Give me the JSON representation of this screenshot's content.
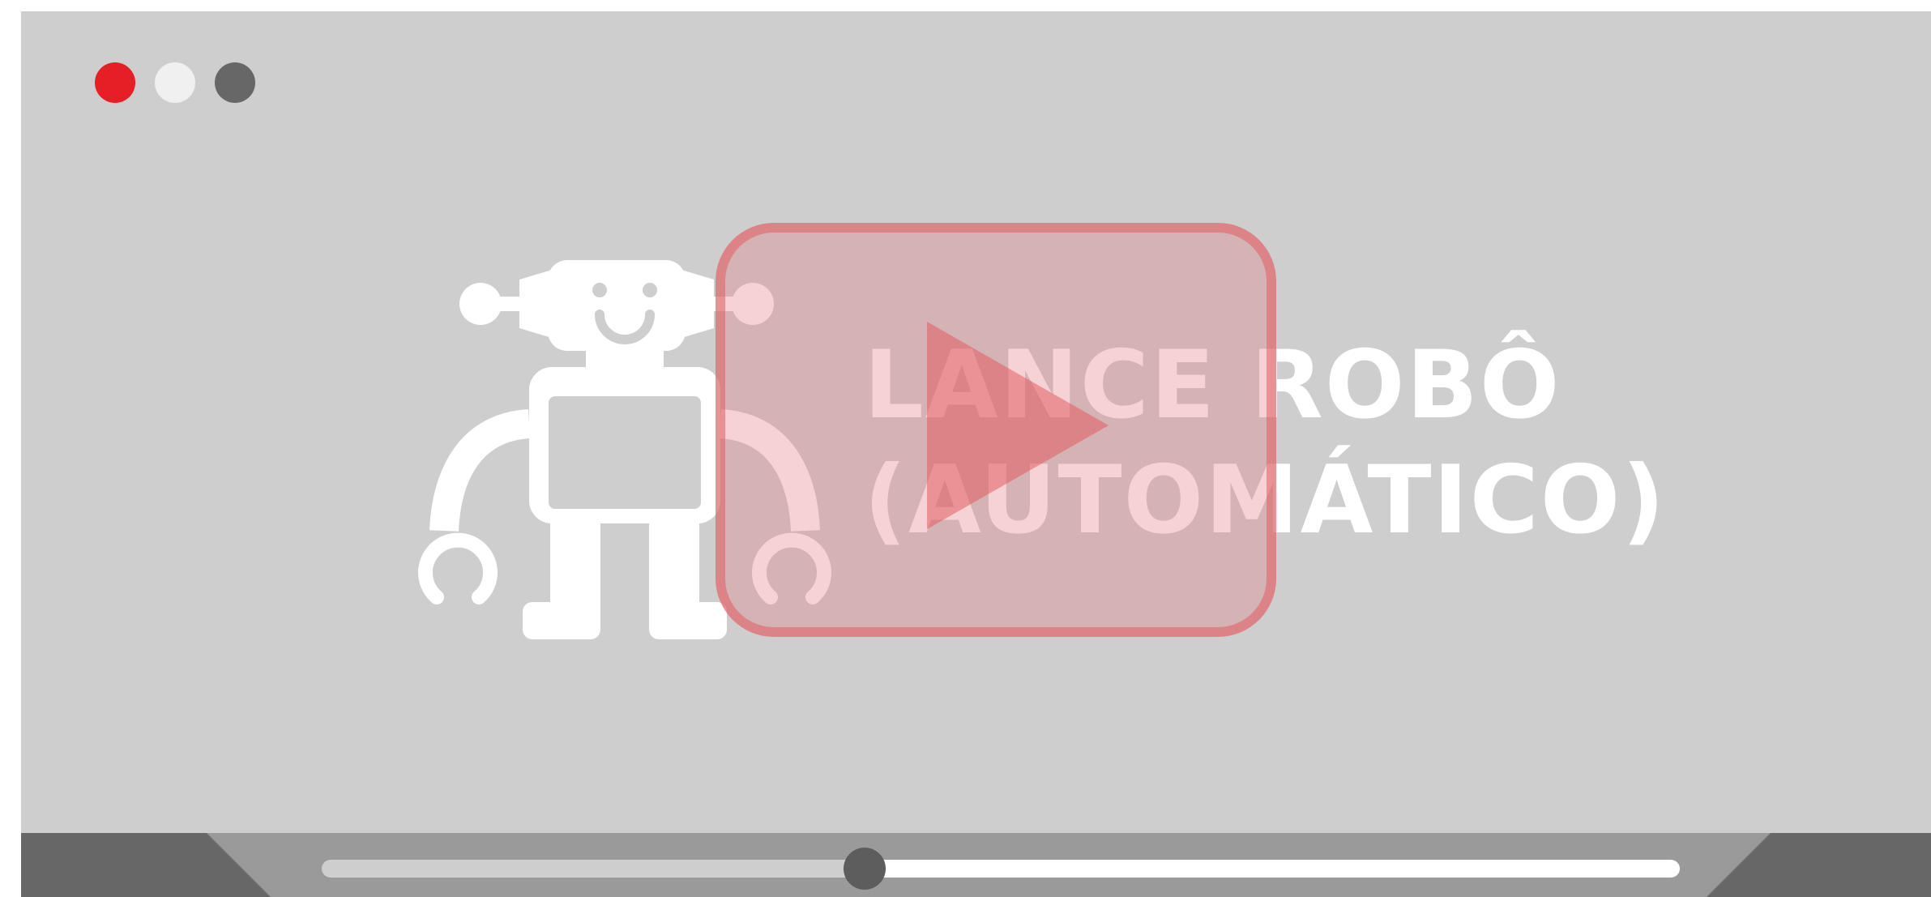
{
  "player": {
    "title_line1": "LANCE ROBÔ",
    "title_line2": "(AUTOMÁTICO)",
    "thumbnail": "robot-illustration"
  },
  "window_controls": {
    "close_color": "#e61f27",
    "minimize_color": "#eff0ef",
    "maximize_color": "#676767"
  },
  "playback": {
    "progress": 0.4,
    "state": "paused"
  },
  "icons": {
    "play": "play-icon",
    "robot": "robot-icon"
  },
  "colors": {
    "background": "#cdcecd",
    "control_bar": "#676767",
    "accent": "#e25c62"
  }
}
